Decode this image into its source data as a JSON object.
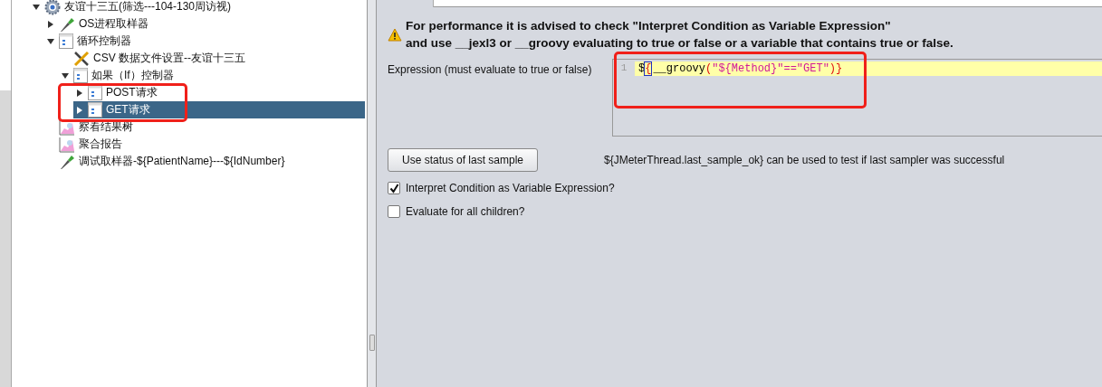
{
  "tree": [
    {
      "label": "友谊十三五(筛选---104-130周访视)",
      "kind": "test-plan",
      "expanded": true,
      "selected": false,
      "children": [
        {
          "label": "OS进程取样器",
          "kind": "sampler",
          "expanded": false,
          "selected": false
        },
        {
          "label": "循环控制器",
          "kind": "controller",
          "expanded": true,
          "selected": false,
          "children": [
            {
              "label": "CSV 数据文件设置--友谊十三五",
              "kind": "config",
              "selected": false
            },
            {
              "label": "如果（If）控制器",
              "kind": "controller",
              "expanded": true,
              "selected": false,
              "children": [
                {
                  "label": "POST请求",
                  "kind": "controller",
                  "expanded": false,
                  "selected": false
                },
                {
                  "label": "GET请求",
                  "kind": "controller",
                  "expanded": false,
                  "selected": true
                }
              ]
            }
          ]
        },
        {
          "label": "察看结果树",
          "kind": "listener",
          "selected": false
        },
        {
          "label": "聚合报告",
          "kind": "listener",
          "selected": false
        },
        {
          "label": "调试取样器-${PatientName}---${IdNumber}",
          "kind": "sampler",
          "selected": false
        }
      ]
    }
  ],
  "warning": {
    "lines": [
      "For performance it is advised to check \"Interpret Condition as Variable Expression\"",
      "and use __jexl3 or __groovy evaluating to true or false or a variable that contains true or false."
    ]
  },
  "expression": {
    "label": "Expression (must evaluate to true or false)",
    "line_number": "1",
    "tokens": [
      {
        "text": "$",
        "kind": "plain"
      },
      {
        "text": "{",
        "kind": "matched-bracket"
      },
      {
        "text": "__groovy",
        "kind": "plain"
      },
      {
        "text": "(",
        "kind": "bracket"
      },
      {
        "text": "\"${Method}\"==\"GET\"",
        "kind": "string"
      },
      {
        "text": ")}",
        "kind": "bracket"
      }
    ]
  },
  "status_button": "Use status of last sample",
  "status_hint": "${JMeterThread.last_sample_ok} can be used to test if last sampler was successful",
  "options": [
    {
      "label": "Interpret Condition as Variable Expression?",
      "checked": true
    },
    {
      "label": "Evaluate for all children?",
      "checked": false
    }
  ]
}
